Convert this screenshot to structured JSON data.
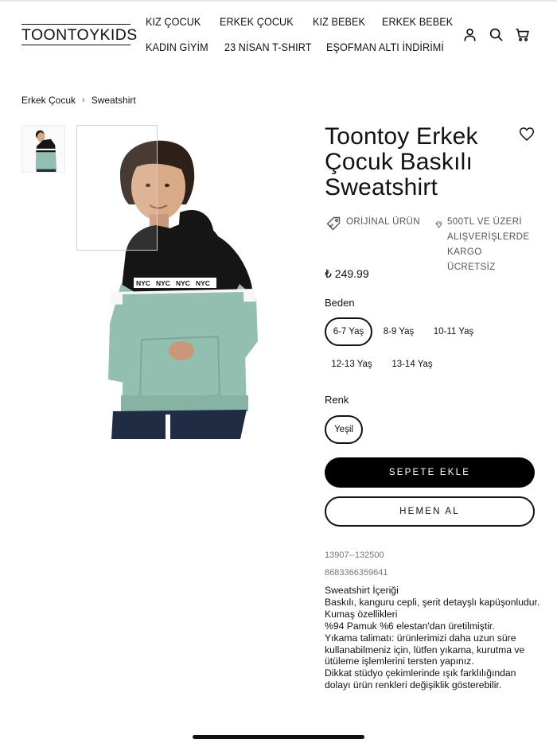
{
  "brand": {
    "logo_text": "TOONTOYKIDS"
  },
  "nav": {
    "row1": [
      "KIZ ÇOCUK",
      "ERKEK ÇOCUK",
      "KIZ BEBEK",
      "ERKEK BEBEK"
    ],
    "row2": [
      "KADIN GİYİM",
      "23 NİSAN T-SHIRT",
      "EŞOFMAN ALTI İNDİRİMİ"
    ]
  },
  "header_icons": [
    "user-icon",
    "search-icon",
    "cart-icon"
  ],
  "breadcrumb": {
    "items": [
      "Erkek Çocuk",
      "Sweatshirt"
    ],
    "separator": "›"
  },
  "product": {
    "title": "Toontoy Erkek Çocuk Baskılı Sweatshirt",
    "badges": {
      "original": "ORİJİNAL ÜRÜN",
      "shipping_line1": "500TL VE ÜZERİ",
      "shipping_line2": "ALIŞVERİŞLERDE",
      "shipping_line3": "KARGO ÜCRETSİZ"
    },
    "price": "₺ 249.99",
    "size_label": "Beden",
    "sizes": [
      "6-7 Yaş",
      "8-9 Yaş",
      "10-11 Yaş",
      "12-13 Yaş",
      "13-14 Yaş"
    ],
    "selected_size": "6-7 Yaş",
    "color_label": "Renk",
    "colors": [
      "Yeşil"
    ],
    "selected_color": "Yeşil",
    "add_to_cart": "SEPETE EKLE",
    "buy_now": "HEMEN AL",
    "sku": "13907--132500",
    "barcode": "8683366359641",
    "print_text": "NYC",
    "description": [
      "Sweatshirt İçeriği",
      "Baskılı, kanguru cepli, şerit detayşlı kapüşonludur.",
      "Kumaş özellikleri",
      "%94 Pamuk %6 elestan'dan üretilmiştir.",
      "Yıkama talimatı: ürünlerimizi daha uzun süre",
      "kullanabilmeniz için, lütfen yıkama, kurutma ve",
      "ütüleme işlemlerini tersten yapınız.",
      "Dikkat stüdyo çekimlerinde ışık farklılığından",
      "dolayı ürün renkleri değişiklik gösterebilir."
    ]
  },
  "colors": {
    "text": "#111111",
    "muted": "#777777",
    "button_primary_bg": "#000000",
    "hoodie_black": "#151515",
    "hoodie_mint": "#93bfb0",
    "jeans": "#1f2c44"
  }
}
